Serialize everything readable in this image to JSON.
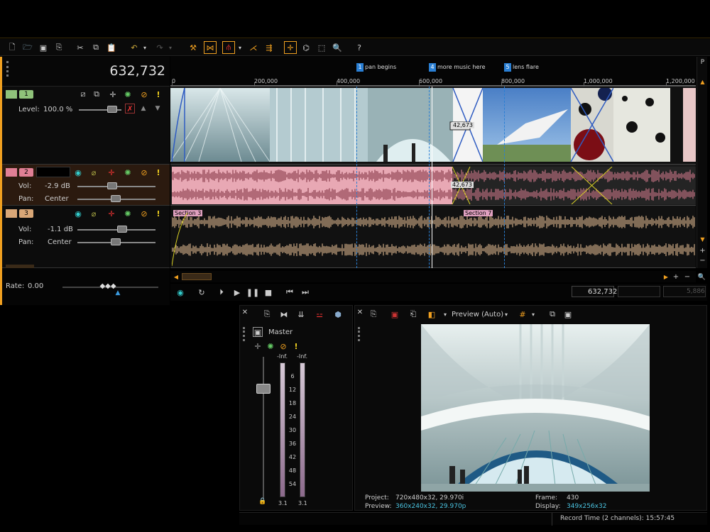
{
  "toolbar": {
    "icons": [
      "new-icon",
      "open-icon",
      "save-icon",
      "properties-icon",
      "cut-icon",
      "copy-icon",
      "paste-icon",
      "undo-icon",
      "redo-icon",
      "normal-edit-icon",
      "envelope-edit-icon",
      "snapping-icon",
      "auto-crossfade-icon",
      "ripple-icon",
      "lock-envelopes-icon",
      "selection-edit-icon",
      "zoom-icon",
      "help-icon"
    ]
  },
  "timecode": "632,732",
  "ruler": {
    "labels": [
      "0",
      "200,000",
      "400,000",
      "600,000",
      "800,000",
      "1,000,000",
      "1,200,000"
    ]
  },
  "markers": [
    {
      "num": "1",
      "label": "pan begins"
    },
    {
      "num": "4",
      "label": "more music here"
    },
    {
      "num": "5",
      "label": "lens flare"
    }
  ],
  "tracks": [
    {
      "num": "1",
      "level_label": "Level:",
      "level_value": "100.0 %",
      "color": "#8fc27a"
    },
    {
      "num": "2",
      "vol_label": "Vol:",
      "vol_value": "-2.9 dB",
      "pan_label": "Pan:",
      "pan_value": "Center",
      "color": "#e07f95"
    },
    {
      "num": "3",
      "vol_label": "Vol:",
      "vol_value": "-1.1 dB",
      "pan_label": "Pan:",
      "pan_value": "Center",
      "color": "#d9a777"
    }
  ],
  "crossfade_labels": [
    "42,673",
    "42,673"
  ],
  "regions": [
    "Section 3",
    "Section 7"
  ],
  "rate": {
    "label": "Rate:",
    "value": "0.00"
  },
  "transport": {
    "cursor_pos": "632,732",
    "end_value": "5,886"
  },
  "master": {
    "title": "Master",
    "meter_top": [
      "-Inf.",
      "-Inf."
    ],
    "scale": [
      "6",
      "12",
      "18",
      "24",
      "30",
      "36",
      "42",
      "48",
      "54"
    ],
    "bottom_values": [
      "3.1",
      "3.1"
    ]
  },
  "preview": {
    "mode": "Preview (Auto)",
    "project_label": "Project:",
    "project_value": "720x480x32, 29.970i",
    "preview_label": "Preview:",
    "preview_value": "360x240x32, 29.970p",
    "frame_label": "Frame:",
    "frame_value": "430",
    "display_label": "Display:",
    "display_value": "349x256x32"
  },
  "status": {
    "record_time": "Record Time (2 channels): 15:57:45"
  },
  "colors": {
    "accent_orange": "#f0a020",
    "video_track": "#8fc27a",
    "audio1": "#e07f95",
    "audio2": "#f1c89a",
    "marker_blue": "#2a7fd4"
  }
}
